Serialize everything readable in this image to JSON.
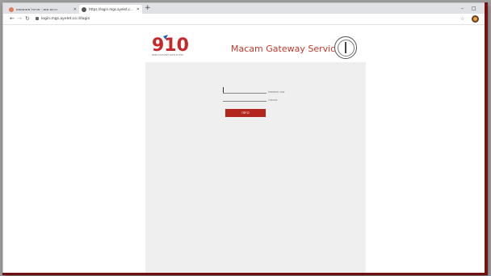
{
  "browser": {
    "tabs": [
      {
        "title": "רכזות ממג - פורטל משתמשים",
        "active": false
      },
      {
        "title": "https://login.mgs.ayelet.co.il/lo...",
        "active": true
      }
    ],
    "new_tab": "+",
    "url": "login.mgs.ayelet.co.il/login",
    "window_controls": {
      "minimize": "–",
      "maximize": "□"
    }
  },
  "header": {
    "logo_text": "910",
    "logo_subtext": "שירות גישה למערכות ממג",
    "brand_word1": "Macam",
    "brand_word2": "Gateway",
    "brand_word3": "Services"
  },
  "login": {
    "username_label": "שם משתמש",
    "password_label": "סיסמה",
    "submit_label": "כניסה"
  },
  "colors": {
    "accent": "#b3261e",
    "brand_text": "#c0392b",
    "content_bg": "#efefef"
  }
}
